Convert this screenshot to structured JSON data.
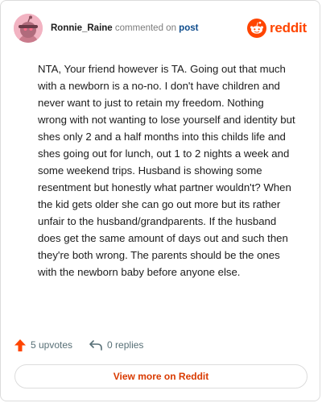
{
  "header": {
    "username": "Ronnie_Raine",
    "action_text": "commented on",
    "post_link": "post",
    "logo_text": "reddit"
  },
  "comment": {
    "body": "NTA, Your friend however is TA. Going out that much with a newborn is a no-no. I don't have children and never want to just to retain my freedom. Nothing wrong with not wanting to lose yourself and identity but shes only 2 and a half months into this childs life and shes going out for lunch, out 1 to 2 nights a week and some weekend trips. Husband is showing some resentment but honestly what partner wouldn't? When the kid gets older she can go out more but its rather unfair to the husband/grandparents. If the husband does get the same amount of days out and such then they're both wrong. The parents should be the ones with the newborn baby before anyone else."
  },
  "actions": {
    "upvotes_label": "5 upvotes",
    "upvote_icon": "upvote-arrow-icon",
    "replies_label": "0 replies",
    "reply_icon": "reply-arrow-icon"
  },
  "footer": {
    "view_more_label": "View more on Reddit"
  },
  "colors": {
    "brand": "#ff4500",
    "link": "#0e4c8c",
    "button_text": "#d93a00",
    "avatar_bg": "#f2b3c2"
  }
}
